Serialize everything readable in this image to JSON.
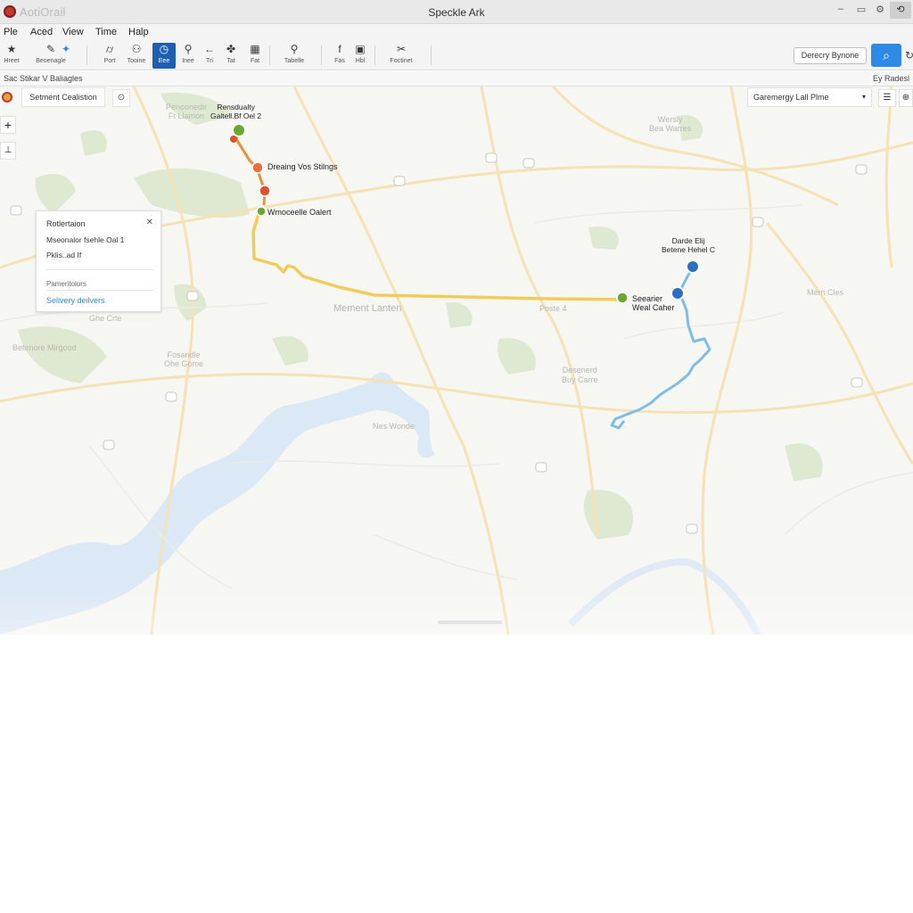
{
  "window": {
    "app_name": "AotiOrail",
    "title": "Speckle Ark",
    "controls": {
      "minimize": "–",
      "maximize": "▭",
      "settings": "⚙",
      "close": "⟲"
    }
  },
  "menu": [
    "Ple",
    "Aced",
    "View",
    "Time",
    "Halp"
  ],
  "toolbar": {
    "tools": [
      {
        "label": "Hreet",
        "icon": "★"
      },
      {
        "label": "Beoenagle",
        "icon": "✎"
      },
      {
        "label": "",
        "icon": "✦"
      },
      {
        "label": "Port",
        "icon": "⌭"
      },
      {
        "label": "Tooine",
        "icon": "⚇"
      },
      {
        "label": "Eee",
        "icon": "◷"
      },
      {
        "label": "Inee",
        "icon": "⚲"
      },
      {
        "label": "Tri",
        "icon": "←"
      },
      {
        "label": "Tat",
        "icon": "✤"
      },
      {
        "label": "Fat",
        "icon": "▦"
      },
      {
        "label": "Tabelle",
        "icon": "⚲"
      },
      {
        "label": "Fas",
        "icon": "f"
      },
      {
        "label": "Hbl",
        "icon": "▣"
      },
      {
        "label": "Foctinet",
        "icon": "✂"
      }
    ],
    "directions_button": "Derecry Bynone",
    "search_icon": "⌕",
    "refresh_icon": "↻"
  },
  "strip": {
    "left": "Sac Stikar  V  Baliagles",
    "right": "Ey Radesl"
  },
  "map": {
    "layer_chip": "Setment Cealistion",
    "layer_chip_icon": "⊙",
    "route_select": "Garemergy Lall Plme",
    "route_select_caret": "▾",
    "ctl_filter": "☰",
    "ctl_pin": "⊕",
    "zoom_in": "+",
    "zoom_out": "⊥",
    "info_panel": {
      "title": "Rotlertaion",
      "close": "✕",
      "line1": "Mseonalor fsehle Oal 1",
      "line2": "Pklis..ad If",
      "section": "Pameritolors",
      "link": "Selivery deilvers"
    },
    "stop_labels": {
      "a": "Rensdualty\nGaltell.Bf Oel 2",
      "b": "Dreaing Vos Stilngs",
      "c": "Wmoceelle Oalert",
      "d": "Darde Elij\nBetene Hehel C",
      "e": "Seearier\nWeal Caher"
    },
    "places": {
      "p1": "Penoonedir\nFt Llamon",
      "p2": "Wersly\nBea Warres",
      "p3": "Mement Lanten",
      "p4": "Poste 4",
      "p5": "Mern Cles",
      "p6": "Desenerd\nBuy Carre",
      "p7": "Nes Wonde",
      "p8": "Betenore Mirgood",
      "p9": "Fosandle\nOhe Gome",
      "p10": "Ghe Crte"
    },
    "route_colors": {
      "yellow": "#f2cc5a",
      "orange": "#e8903a",
      "blue": "#7dbde6",
      "green": "#6aa632",
      "red": "#d9532b",
      "navy": "#2e6fc2"
    }
  }
}
